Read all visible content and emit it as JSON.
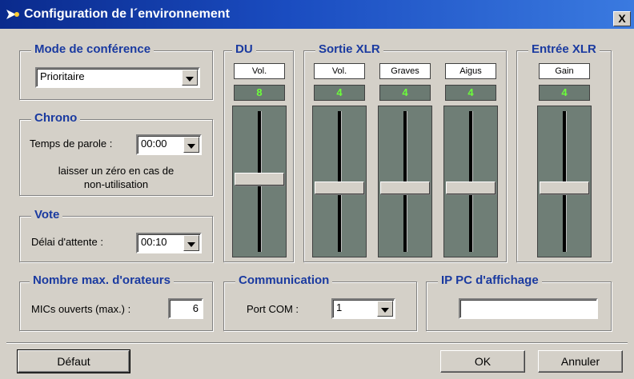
{
  "window": {
    "title": "Configuration de l´environnement",
    "close_label": "X"
  },
  "mode": {
    "title": "Mode de conférence",
    "value": "Prioritaire"
  },
  "chrono": {
    "title": "Chrono",
    "label": "Temps de parole :",
    "value": "00:00",
    "note_line1": "laisser un zéro en cas de",
    "note_line2": "non-utilisation"
  },
  "vote": {
    "title": "Vote",
    "label": "Délai d'attente :",
    "value": "00:10"
  },
  "du": {
    "title": "DU",
    "channel": {
      "label": "Vol.",
      "value": "8",
      "level_fraction": 0.52
    }
  },
  "sortie": {
    "title": "Sortie XLR",
    "channels": [
      {
        "label": "Vol.",
        "value": "4",
        "level_fraction": 0.45
      },
      {
        "label": "Graves",
        "value": "4",
        "level_fraction": 0.45
      },
      {
        "label": "Aigus",
        "value": "4",
        "level_fraction": 0.45
      }
    ]
  },
  "entree": {
    "title": "Entrée XLR",
    "channel": {
      "label": "Gain",
      "value": "4",
      "level_fraction": 0.45
    }
  },
  "orateurs": {
    "title": "Nombre max. d'orateurs",
    "label": "MICs ouverts (max.) :",
    "value": "6"
  },
  "communication": {
    "title": "Communication",
    "label": "Port COM :",
    "value": "1"
  },
  "ip": {
    "title": "IP PC d'affichage",
    "value": ""
  },
  "buttons": {
    "default_label": "Défaut",
    "ok_label": "OK",
    "cancel_label": "Annuler"
  },
  "colors": {
    "title_bar_start": "#0a2a8c",
    "group_title": "#1a3aa0",
    "display_digits": "#6cff3a",
    "slider_bg": "#6f7e76"
  }
}
